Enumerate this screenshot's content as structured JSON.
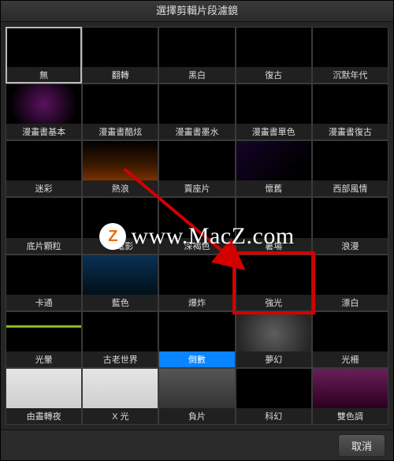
{
  "window": {
    "title": "選擇剪輯片段濾鏡"
  },
  "footer": {
    "cancel_label": "取消"
  },
  "filters": [
    {
      "label": "無",
      "selected": true,
      "cls": ""
    },
    {
      "label": "翻轉",
      "cls": ""
    },
    {
      "label": "黑白",
      "cls": ""
    },
    {
      "label": "復古",
      "cls": ""
    },
    {
      "label": "沉默年代",
      "cls": ""
    },
    {
      "label": "漫畫書基本",
      "cls": "c-purple"
    },
    {
      "label": "漫畫書酷炫",
      "cls": ""
    },
    {
      "label": "漫畫書墨水",
      "cls": ""
    },
    {
      "label": "漫畫書單色",
      "cls": ""
    },
    {
      "label": "漫畫書復古",
      "cls": ""
    },
    {
      "label": "迷彩",
      "cls": ""
    },
    {
      "label": "熱浪",
      "cls": "c-orange"
    },
    {
      "label": "賣座片",
      "cls": ""
    },
    {
      "label": "懷舊",
      "cls": "c-dpurple"
    },
    {
      "label": "西部風情",
      "cls": ""
    },
    {
      "label": "底片顆粒",
      "cls": ""
    },
    {
      "label": "老電影",
      "cls": ""
    },
    {
      "label": "深褐色",
      "cls": ""
    },
    {
      "label": "暑場",
      "cls": ""
    },
    {
      "label": "浪漫",
      "cls": ""
    },
    {
      "label": "卡通",
      "cls": ""
    },
    {
      "label": "藍色",
      "cls": "c-teal"
    },
    {
      "label": "爆炸",
      "cls": ""
    },
    {
      "label": "強光",
      "cls": ""
    },
    {
      "label": "漂白",
      "cls": ""
    },
    {
      "label": "光暈",
      "cls": "c-lime"
    },
    {
      "label": "古老世界",
      "cls": ""
    },
    {
      "label": "倒數",
      "highlight": true,
      "cls": ""
    },
    {
      "label": "夢幻",
      "cls": "c-warmgray"
    },
    {
      "label": "光柵",
      "cls": ""
    },
    {
      "label": "由晝轉夜",
      "cls": "c-white"
    },
    {
      "label": "X 光",
      "cls": "c-white"
    },
    {
      "label": "負片",
      "cls": "c-gray"
    },
    {
      "label": "科幻",
      "cls": ""
    },
    {
      "label": "雙色調",
      "cls": "c-pink"
    }
  ],
  "annotation": {
    "redbox_target_index": 23,
    "arrow_from_index": 11
  },
  "watermark": {
    "badge_letter": "Z",
    "text": "www.MacZ.com"
  }
}
